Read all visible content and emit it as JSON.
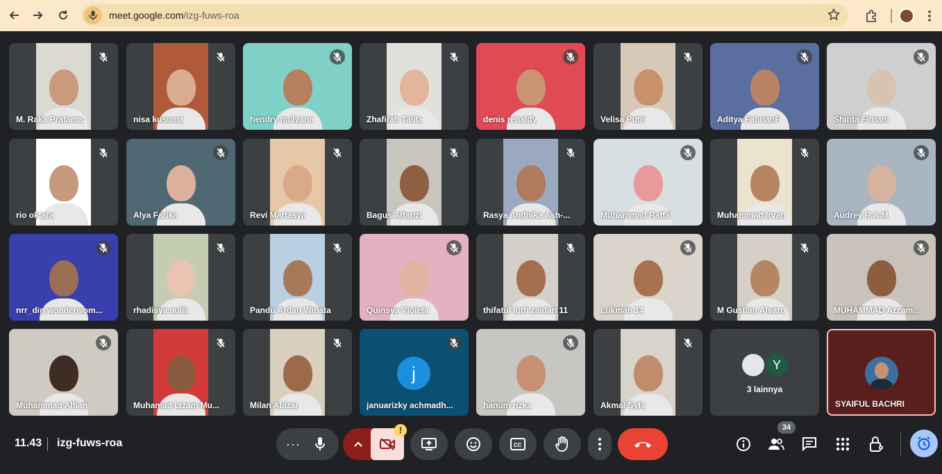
{
  "browser": {
    "url_host": "meet.google.com",
    "url_path": "/izg-fuws-roa"
  },
  "participants": [
    {
      "name": "M. Raka Pratama.",
      "bg": "#dcd8d2",
      "skin": "#c99b7c",
      "full": false
    },
    {
      "name": "nisa kusuma",
      "bg": "#b05a3a",
      "skin": "#d9ad8f",
      "full": false
    },
    {
      "name": "hendry mulyana",
      "bg": "#7fd0c6",
      "skin": "#b57f60",
      "full": true
    },
    {
      "name": "Zhafirah Talita",
      "bg": "#e2e0da",
      "skin": "#e3b59a",
      "full": false
    },
    {
      "name": "denis renaldy",
      "bg": "#e04a55",
      "skin": "#c99473",
      "full": true
    },
    {
      "name": "Velisa Putri",
      "bg": "#d7c9b8",
      "skin": "#c8906b",
      "full": false
    },
    {
      "name": "Aditya FahrianF",
      "bg": "#5a6ea0",
      "skin": "#b88366",
      "full": true
    },
    {
      "name": "Shinta Fitriani",
      "bg": "#cfcfcf",
      "skin": "#d8c2b0",
      "full": true
    },
    {
      "name": "rio oktara",
      "bg": "#ffffff",
      "skin": "#c69a7c",
      "full": false
    },
    {
      "name": "Alya Farika",
      "bg": "#4f6873",
      "skin": "#dcb09a",
      "full": true
    },
    {
      "name": "Revi Martasya",
      "bg": "#e6c8a8",
      "skin": "#d9a98a",
      "full": false
    },
    {
      "name": "Bagus Alfarizi",
      "bg": "#c9c6c0",
      "skin": "#8f5f42",
      "full": false
    },
    {
      "name": "Rasya Andhika Ash-...",
      "bg": "#9ba9c0",
      "skin": "#b07b5c",
      "full": false
    },
    {
      "name": "Muhammad Raffal",
      "bg": "#d8dfe2",
      "skin": "#e89a9a",
      "full": true
    },
    {
      "name": "Muhammad Irvan",
      "bg": "#ece3cf",
      "skin": "#b88563",
      "full": false
    },
    {
      "name": "Audrey R.A.M",
      "bg": "#a9b6c2",
      "skin": "#d6b3a0",
      "full": true
    },
    {
      "name": "nrr_din wonderwom...",
      "bg": "#3a3fae",
      "skin": "#9a6e54",
      "full": true
    },
    {
      "name": "rhadisya aulia",
      "bg": "#c4cdb2",
      "skin": "#eac3b2",
      "full": false
    },
    {
      "name": "Pandu Ardan Winata",
      "bg": "#b9d0e2",
      "skin": "#a8785a",
      "full": false
    },
    {
      "name": "Quinsya Violeta",
      "bg": "#e4b1c0",
      "skin": "#e0b4a0",
      "full": true
    },
    {
      "name": "thifatul lutfi zaidan 11",
      "bg": "#d3cfc9",
      "skin": "#a36f50",
      "full": false
    },
    {
      "name": "Lukman 14",
      "bg": "#dad4ca",
      "skin": "#a8724f",
      "full": true
    },
    {
      "name": "M Gustian Alvaro",
      "bg": "#d6cfc6",
      "skin": "#b58564",
      "full": false
    },
    {
      "name": "MUHAMMAD Azzam...",
      "bg": "#c8c2ba",
      "skin": "#8e5d40",
      "full": true
    },
    {
      "name": "Muhammad Alfian",
      "bg": "#cfcbc2",
      "skin": "#3f2c22",
      "full": true
    },
    {
      "name": "Muhamad Lizam Mu...",
      "bg": "#d43a3a",
      "skin": "#8a5a3e",
      "full": false
    },
    {
      "name": "Milan Abizar",
      "bg": "#d9cfbf",
      "skin": "#9c6a4b",
      "full": false
    },
    {
      "name": "januarizky achmadh...",
      "bg": "#0b4f73",
      "skin": "",
      "full": true,
      "initial": "j"
    },
    {
      "name": "hanum rizka",
      "bg": "#c8c6c2",
      "skin": "#c99174",
      "full": true
    },
    {
      "name": "Akmal Syfa",
      "bg": "#d8d3cb",
      "skin": "#c08c6c",
      "full": false
    }
  ],
  "others": {
    "label": "3 lainnya",
    "initial": "Y"
  },
  "host": {
    "name": "SYAIFUL BACHRI"
  },
  "meeting": {
    "time": "11.43",
    "code": "izg-fuws-roa",
    "people_count": "34"
  },
  "colors": {
    "end_call": "#ea4335",
    "camera_off": "#f9dedc",
    "raise_hand_btn": "#3c4043"
  }
}
